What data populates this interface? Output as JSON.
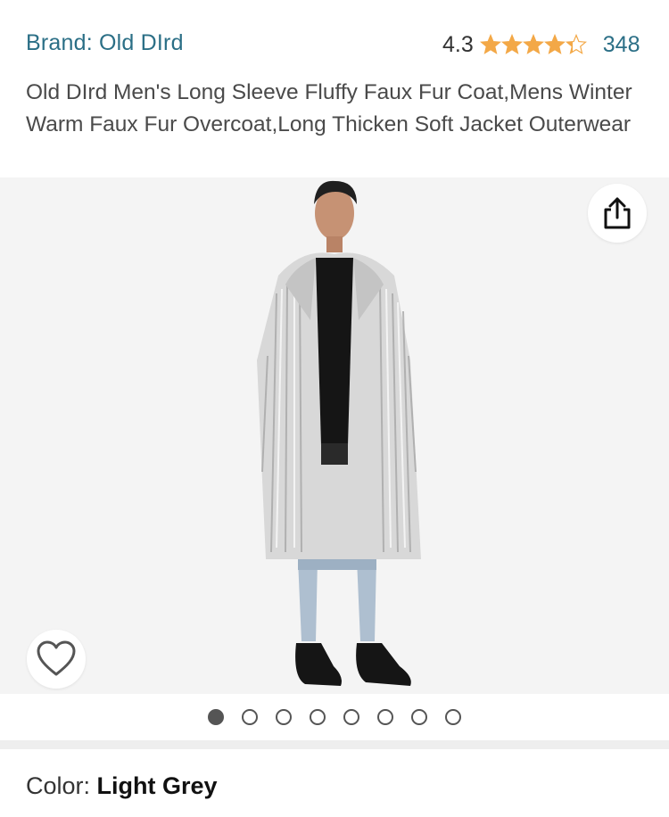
{
  "header": {
    "brand_label": "Brand: Old DIrd",
    "rating_value": "4.3",
    "rating_stars": 4.3,
    "review_count": "348"
  },
  "product": {
    "title": "Old DIrd Men's Long Sleeve Fluffy Faux Fur Coat,Mens Winter Warm Faux Fur Overcoat,Long Thicken Soft Jacket Outerwear"
  },
  "gallery": {
    "share_icon": "share-icon",
    "wishlist_icon": "heart-icon",
    "image_count": 8,
    "active_index": 0
  },
  "variant": {
    "color_label": "Color: ",
    "color_value": "Light Grey"
  },
  "colors": {
    "link": "#2b6f86",
    "star": "#f3a847",
    "gallery_bg": "#f4f4f4"
  }
}
